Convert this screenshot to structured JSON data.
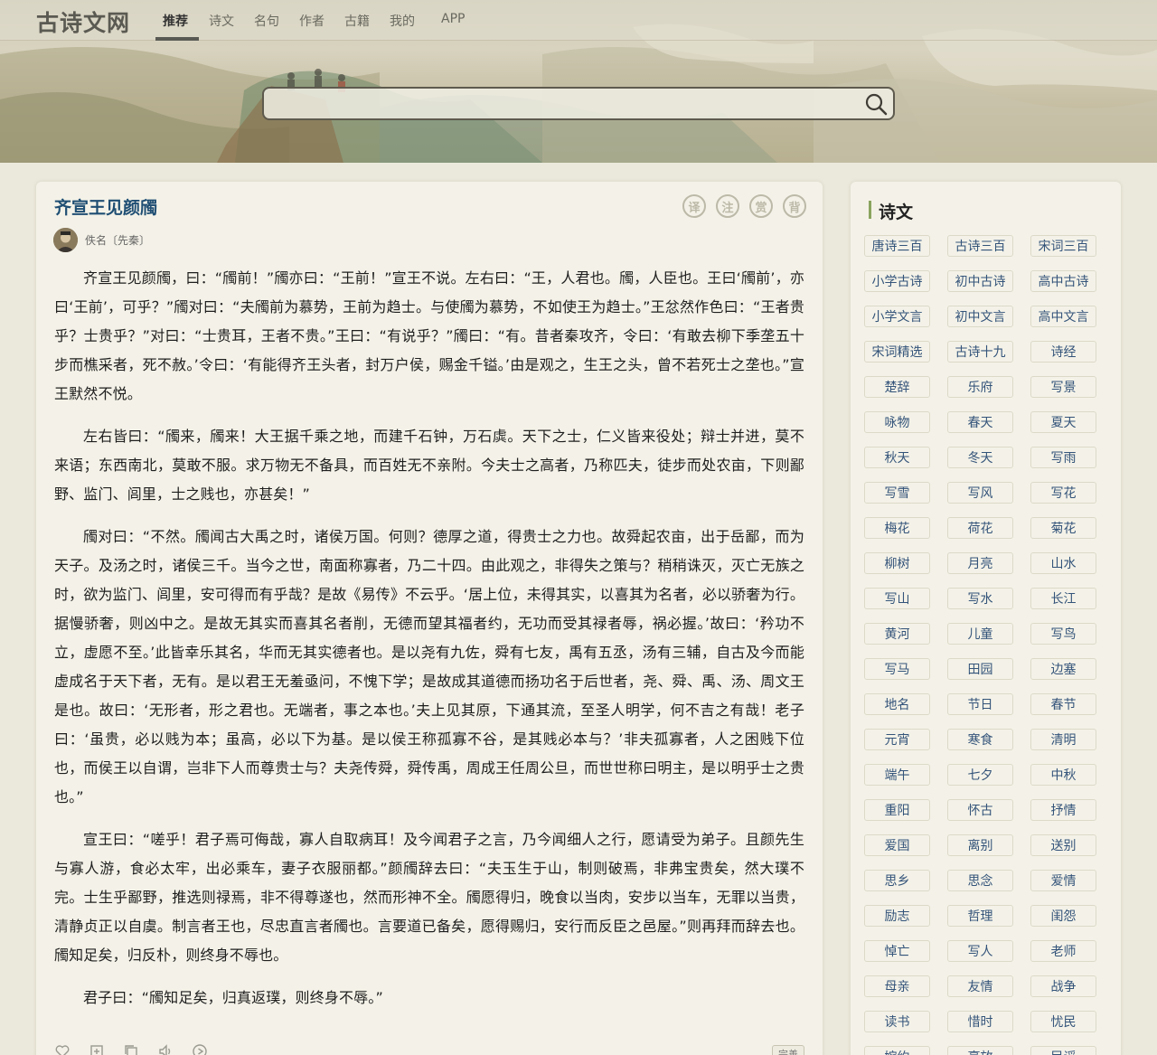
{
  "site": {
    "logo": "古诗文网"
  },
  "nav": {
    "items": [
      "推荐",
      "诗文",
      "名句",
      "作者",
      "古籍",
      "我的",
      "APP"
    ],
    "active": "推荐"
  },
  "search": {
    "value": "",
    "placeholder": ""
  },
  "poem": {
    "title": "齐宣王见颜斶",
    "author": "佚名〔先秦〕",
    "tools": [
      "译",
      "注",
      "赏",
      "背"
    ],
    "paragraphs": [
      "齐宣王见颜斶，曰：“斶前！”斶亦曰：“王前！”宣王不说。左右曰：“王，人君也。斶，人臣也。王曰‘斶前’，亦曰‘王前’，可乎？”斶对曰：“夫斶前为慕势，王前为趋士。与使斶为慕势，不如使王为趋士。”王忿然作色曰：“王者贵乎？士贵乎？”对曰：“士贵耳，王者不贵。”王曰：“有说乎？”斶曰：“有。昔者秦攻齐，令曰：‘有敢去柳下季垄五十步而樵采者，死不赦。’令曰：‘有能得齐王头者，封万户侯，赐金千镒。’由是观之，生王之头，曾不若死士之垄也。”宣王默然不悦。",
      "左右皆曰：“斶来，斶来！大王据千乘之地，而建千石钟，万石虡。天下之士，仁义皆来役处；辩士并进，莫不来语；东西南北，莫敢不服。求万物无不备具，而百姓无不亲附。今夫士之高者，乃称匹夫，徒步而处农亩，下则鄙野、监门、闾里，士之贱也，亦甚矣！”",
      "斶对曰：“不然。斶闻古大禹之时，诸侯万国。何则？德厚之道，得贵士之力也。故舜起农亩，出于岳鄙，而为天子。及汤之时，诸侯三千。当今之世，南面称寡者，乃二十四。由此观之，非得失之策与？稍稍诛灭，灭亡无族之时，欲为监门、闾里，安可得而有乎哉？是故《易传》不云乎。‘居上位，未得其实，以喜其为名者，必以骄奢为行。据慢骄奢，则凶中之。是故无其实而喜其名者削，无德而望其福者约，无功而受其禄者辱，祸必握。’故曰：‘矜功不立，虚愿不至。’此皆幸乐其名，华而无其实德者也。是以尧有九佐，舜有七友，禹有五丞，汤有三辅，自古及今而能虚成名于天下者，无有。是以君王无羞亟问，不愧下学；是故成其道德而扬功名于后世者，尧、舜、禹、汤、周文王是也。故曰：‘无形者，形之君也。无端者，事之本也。’夫上见其原，下通其流，至圣人明学，何不吉之有哉！老子曰：‘虽贵，必以贱为本；虽高，必以下为基。是以侯王称孤寡不谷，是其贱必本与？’非夫孤寡者，人之困贱下位也，而侯王以自谓，岂非下人而尊贵士与？夫尧传舜，舜传禹，周成王任周公旦，而世世称曰明主，是以明乎士之贵也。”",
      "宣王曰：“嗟乎！君子焉可侮哉，寡人自取病耳！及今闻君子之言，乃今闻细人之行，愿请受为弟子。且颜先生与寡人游，食必太牢，出必乘车，妻子衣服丽都。”颜斶辞去曰：“夫玉生于山，制则破焉，非弗宝贵矣，然大璞不完。士生乎鄙野，推选则禄焉，非不得尊遂也，然而形神不全。斶愿得归，晚食以当肉，安步以当车，无罪以当贵，清静贞正以自虞。制言者王也，尽忠直言者斶也。言要道已备矣，愿得赐归，安行而反臣之邑屋。”则再拜而辞去也。斶知足矣，归反朴，则终身不辱也。",
      "君子曰：“斶知足矣，归真返璞，则终身不辱。”"
    ],
    "complete_label": "完善"
  },
  "sidebar": {
    "title": "诗文",
    "tags": [
      "唐诗三百",
      "古诗三百",
      "宋词三百",
      "小学古诗",
      "初中古诗",
      "高中古诗",
      "小学文言",
      "初中文言",
      "高中文言",
      "宋词精选",
      "古诗十九",
      "诗经",
      "楚辞",
      "乐府",
      "写景",
      "咏物",
      "春天",
      "夏天",
      "秋天",
      "冬天",
      "写雨",
      "写雪",
      "写风",
      "写花",
      "梅花",
      "荷花",
      "菊花",
      "柳树",
      "月亮",
      "山水",
      "写山",
      "写水",
      "长江",
      "黄河",
      "儿童",
      "写鸟",
      "写马",
      "田园",
      "边塞",
      "地名",
      "节日",
      "春节",
      "元宵",
      "寒食",
      "清明",
      "端午",
      "七夕",
      "中秋",
      "重阳",
      "怀古",
      "抒情",
      "爱国",
      "离别",
      "送别",
      "思乡",
      "思念",
      "爱情",
      "励志",
      "哲理",
      "闺怨",
      "悼亡",
      "写人",
      "老师",
      "母亲",
      "友情",
      "战争",
      "读书",
      "惜时",
      "忧民",
      "婉约",
      "豪放",
      "民谣"
    ]
  },
  "colors": {
    "title_link": "#1f4e73",
    "tag_text": "#34547a",
    "sidebar_accent": "#8aa45e",
    "page_bg": "#ebe9dc",
    "card_bg": "#f4f2e8"
  },
  "icons": [
    "search-icon",
    "heart-icon",
    "edit-icon",
    "copy-icon",
    "audio-icon",
    "play-icon"
  ]
}
